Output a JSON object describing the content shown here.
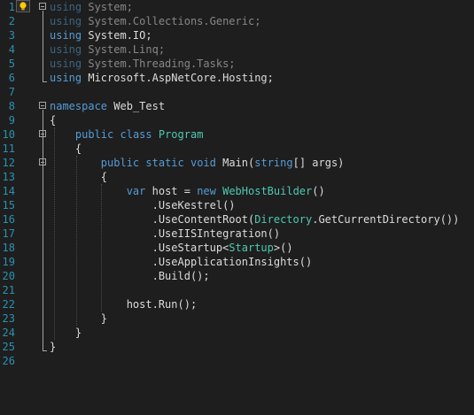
{
  "editor": {
    "lines": [
      {
        "n": "1",
        "segs": [
          {
            "t": "using",
            "c": "kw"
          },
          {
            "t": " System;",
            "c": ""
          }
        ],
        "dim": true
      },
      {
        "n": "2",
        "segs": [
          {
            "t": "using",
            "c": "kw"
          },
          {
            "t": " System.Collections.Generic;",
            "c": ""
          }
        ],
        "dim": true
      },
      {
        "n": "3",
        "segs": [
          {
            "t": "using",
            "c": "kw"
          },
          {
            "t": " System.IO;",
            "c": ""
          }
        ],
        "dim": false
      },
      {
        "n": "4",
        "segs": [
          {
            "t": "using",
            "c": "kw"
          },
          {
            "t": " System.Linq;",
            "c": ""
          }
        ],
        "dim": true
      },
      {
        "n": "5",
        "segs": [
          {
            "t": "using",
            "c": "kw"
          },
          {
            "t": " System.Threading.Tasks;",
            "c": ""
          }
        ],
        "dim": true
      },
      {
        "n": "6",
        "segs": [
          {
            "t": "using",
            "c": "kw"
          },
          {
            "t": " Microsoft.AspNetCore.Hosting;",
            "c": ""
          }
        ],
        "dim": false
      },
      {
        "n": "7",
        "segs": [],
        "dim": false
      },
      {
        "n": "8",
        "segs": [
          {
            "t": "namespace",
            "c": "kw"
          },
          {
            "t": " Web_Test",
            "c": ""
          }
        ],
        "dim": false
      },
      {
        "n": "9",
        "segs": [
          {
            "t": "{",
            "c": ""
          }
        ],
        "dim": false
      },
      {
        "n": "10",
        "segs": [
          {
            "t": "    ",
            "c": ""
          },
          {
            "t": "public",
            "c": "kw"
          },
          {
            "t": " ",
            "c": ""
          },
          {
            "t": "class",
            "c": "kw"
          },
          {
            "t": " ",
            "c": ""
          },
          {
            "t": "Program",
            "c": "ty"
          }
        ],
        "dim": false
      },
      {
        "n": "11",
        "segs": [
          {
            "t": "    {",
            "c": ""
          }
        ],
        "dim": false
      },
      {
        "n": "12",
        "segs": [
          {
            "t": "        ",
            "c": ""
          },
          {
            "t": "public",
            "c": "kw"
          },
          {
            "t": " ",
            "c": ""
          },
          {
            "t": "static",
            "c": "kw"
          },
          {
            "t": " ",
            "c": ""
          },
          {
            "t": "void",
            "c": "kw"
          },
          {
            "t": " Main(",
            "c": ""
          },
          {
            "t": "string",
            "c": "kw"
          },
          {
            "t": "[] args)",
            "c": ""
          }
        ],
        "dim": false
      },
      {
        "n": "13",
        "segs": [
          {
            "t": "        {",
            "c": ""
          }
        ],
        "dim": false
      },
      {
        "n": "14",
        "segs": [
          {
            "t": "            ",
            "c": ""
          },
          {
            "t": "var",
            "c": "kw"
          },
          {
            "t": " host = ",
            "c": ""
          },
          {
            "t": "new",
            "c": "kw"
          },
          {
            "t": " ",
            "c": ""
          },
          {
            "t": "WebHostBuilder",
            "c": "ty"
          },
          {
            "t": "()",
            "c": ""
          }
        ],
        "dim": false
      },
      {
        "n": "15",
        "segs": [
          {
            "t": "                .UseKestrel()",
            "c": ""
          }
        ],
        "dim": false
      },
      {
        "n": "16",
        "segs": [
          {
            "t": "                .UseContentRoot(",
            "c": ""
          },
          {
            "t": "Directory",
            "c": "ty"
          },
          {
            "t": ".GetCurrentDirectory())",
            "c": ""
          }
        ],
        "dim": false
      },
      {
        "n": "17",
        "segs": [
          {
            "t": "                .UseIISIntegration()",
            "c": ""
          }
        ],
        "dim": false
      },
      {
        "n": "18",
        "segs": [
          {
            "t": "                .UseStartup<",
            "c": ""
          },
          {
            "t": "Startup",
            "c": "ty"
          },
          {
            "t": ">()",
            "c": ""
          }
        ],
        "dim": false
      },
      {
        "n": "19",
        "segs": [
          {
            "t": "                .UseApplicationInsights()",
            "c": ""
          }
        ],
        "dim": false
      },
      {
        "n": "20",
        "segs": [
          {
            "t": "                .Build();",
            "c": ""
          }
        ],
        "dim": false
      },
      {
        "n": "21",
        "segs": [],
        "dim": false
      },
      {
        "n": "22",
        "segs": [
          {
            "t": "            host.Run();",
            "c": ""
          }
        ],
        "dim": false
      },
      {
        "n": "23",
        "segs": [
          {
            "t": "        }",
            "c": ""
          }
        ],
        "dim": false
      },
      {
        "n": "24",
        "segs": [
          {
            "t": "    }",
            "c": ""
          }
        ],
        "dim": false
      },
      {
        "n": "25",
        "segs": [
          {
            "t": "}",
            "c": ""
          }
        ],
        "dim": false
      },
      {
        "n": "26",
        "segs": [],
        "dim": false
      }
    ],
    "fold_lines": [
      "1",
      "8",
      "10",
      "12"
    ],
    "lightbulb_line": "1",
    "icons": {
      "lightbulb": "lightbulb-icon",
      "fold": "collapse-icon"
    }
  },
  "colors": {
    "background": "#1e1e1e",
    "line_number": "#2b91af",
    "keyword": "#569cd6",
    "type": "#4ec9b0",
    "text": "#dcdcdc"
  }
}
